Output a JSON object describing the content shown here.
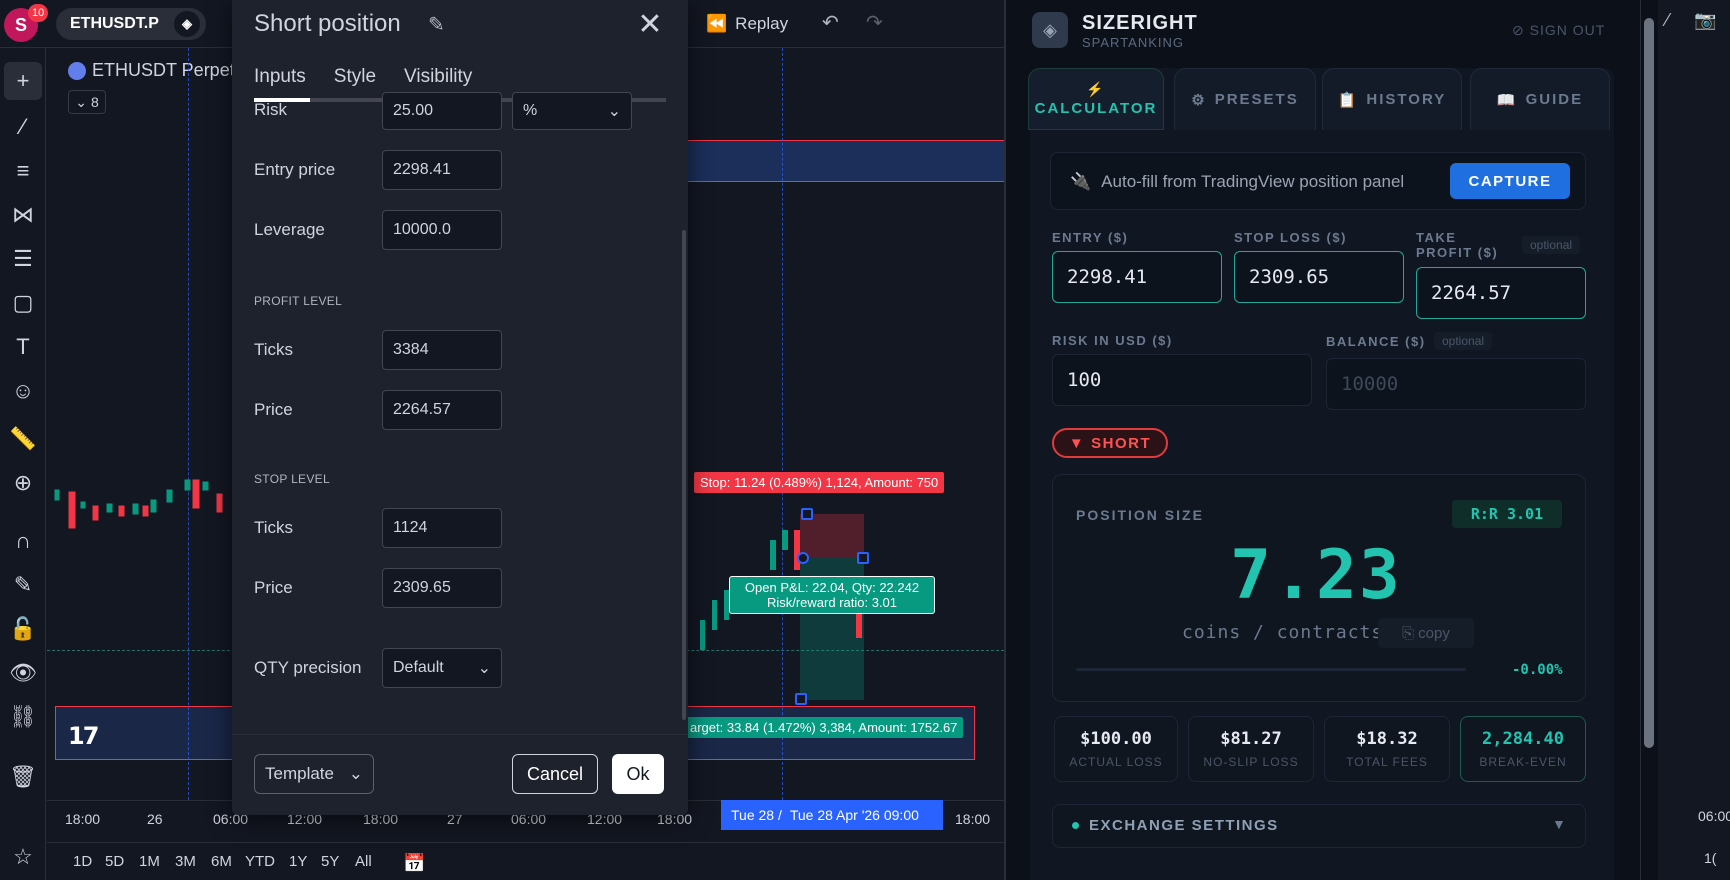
{
  "tv": {
    "avatar_letter": "S",
    "notifications": "10",
    "symbol": "ETHUSDT.P",
    "chart_title": "ETHUSDT Perpet",
    "collapse_count": "8",
    "replay_label": "Replay",
    "stop_label": "Stop: 11.24 (0.489%) 1,124, Amount: 750",
    "target_label": "arget: 33.84 (1.472%) 3,384, Amount: 1752.67",
    "pnl_line1": "Open P&L: 22.04, Qty: 22.242",
    "pnl_line2": "Risk/reward ratio: 3.01",
    "time_ticks": [
      "18:00",
      "26",
      "06:00",
      "12:00",
      "18:00",
      "27",
      "06:00",
      "12:00",
      "18:00",
      "18:00"
    ],
    "time_highlight_a": "Tue 28 /",
    "time_highlight_b": "Tue 28 Apr '26   09:00",
    "ranges": [
      "1D",
      "5D",
      "1M",
      "3M",
      "6M",
      "YTD",
      "1Y",
      "5Y",
      "All"
    ],
    "right_strip_time": "06:00",
    "right_strip_num": "1("
  },
  "dialog": {
    "title": "Short position",
    "tabs": [
      "Inputs",
      "Style",
      "Visibility"
    ],
    "risk_label": "Risk",
    "risk_value": "25.00",
    "risk_unit": "%",
    "entry_label": "Entry price",
    "entry_value": "2298.41",
    "leverage_label": "Leverage",
    "leverage_value": "10000.0",
    "profit_section": "PROFIT LEVEL",
    "profit_ticks_label": "Ticks",
    "profit_ticks_value": "3384",
    "profit_price_label": "Price",
    "profit_price_value": "2264.57",
    "stop_section": "STOP LEVEL",
    "stop_ticks_label": "Ticks",
    "stop_ticks_value": "1124",
    "stop_price_label": "Price",
    "stop_price_value": "2309.65",
    "qty_label": "QTY precision",
    "qty_value": "Default",
    "template_label": "Template",
    "cancel_label": "Cancel",
    "ok_label": "Ok"
  },
  "sizeright": {
    "title": "SIZERIGHT",
    "subtitle": "SPARTANKING",
    "signout": "SIGN OUT",
    "tabs": [
      {
        "label": "CALCULATOR",
        "icon": "lightning-icon"
      },
      {
        "label": "PRESETS",
        "icon": "gear-icon"
      },
      {
        "label": "HISTORY",
        "icon": "clipboard-icon"
      },
      {
        "label": "GUIDE",
        "icon": "book-icon"
      }
    ],
    "autofill_text": "Auto-fill from TradingView position panel",
    "capture_label": "CAPTURE",
    "entry_label": "ENTRY ($)",
    "entry_value": "2298.41",
    "stop_label": "STOP LOSS ($)",
    "stop_value": "2309.65",
    "tp_label_1": "TAKE",
    "tp_label_2": "PROFIT ($)",
    "tp_value": "2264.57",
    "optional": "optional",
    "risk_label": "RISK IN USD ($)",
    "risk_value": "100",
    "balance_label": "BALANCE ($)",
    "balance_placeholder": "10000",
    "direction": "SHORT",
    "position_label": "POSITION SIZE",
    "rr_label": "R:R 3.01",
    "position_size": "7.23",
    "unit": "coins / contracts",
    "copy_label": "copy",
    "slippage": "-0.00%",
    "stats": [
      {
        "value": "$100.00",
        "label": "ACTUAL LOSS"
      },
      {
        "value": "$81.27",
        "label": "NO-SLIP LOSS"
      },
      {
        "value": "$18.32",
        "label": "TOTAL FEES"
      },
      {
        "value": "2,284.40",
        "label": "BREAK-EVEN"
      }
    ],
    "exchange_label": "EXCHANGE SETTINGS"
  },
  "colors": {
    "accent_teal": "#22c4b0",
    "capture_blue": "#1f6fe0",
    "short_red": "#ff5252",
    "tv_bg": "#131722"
  }
}
